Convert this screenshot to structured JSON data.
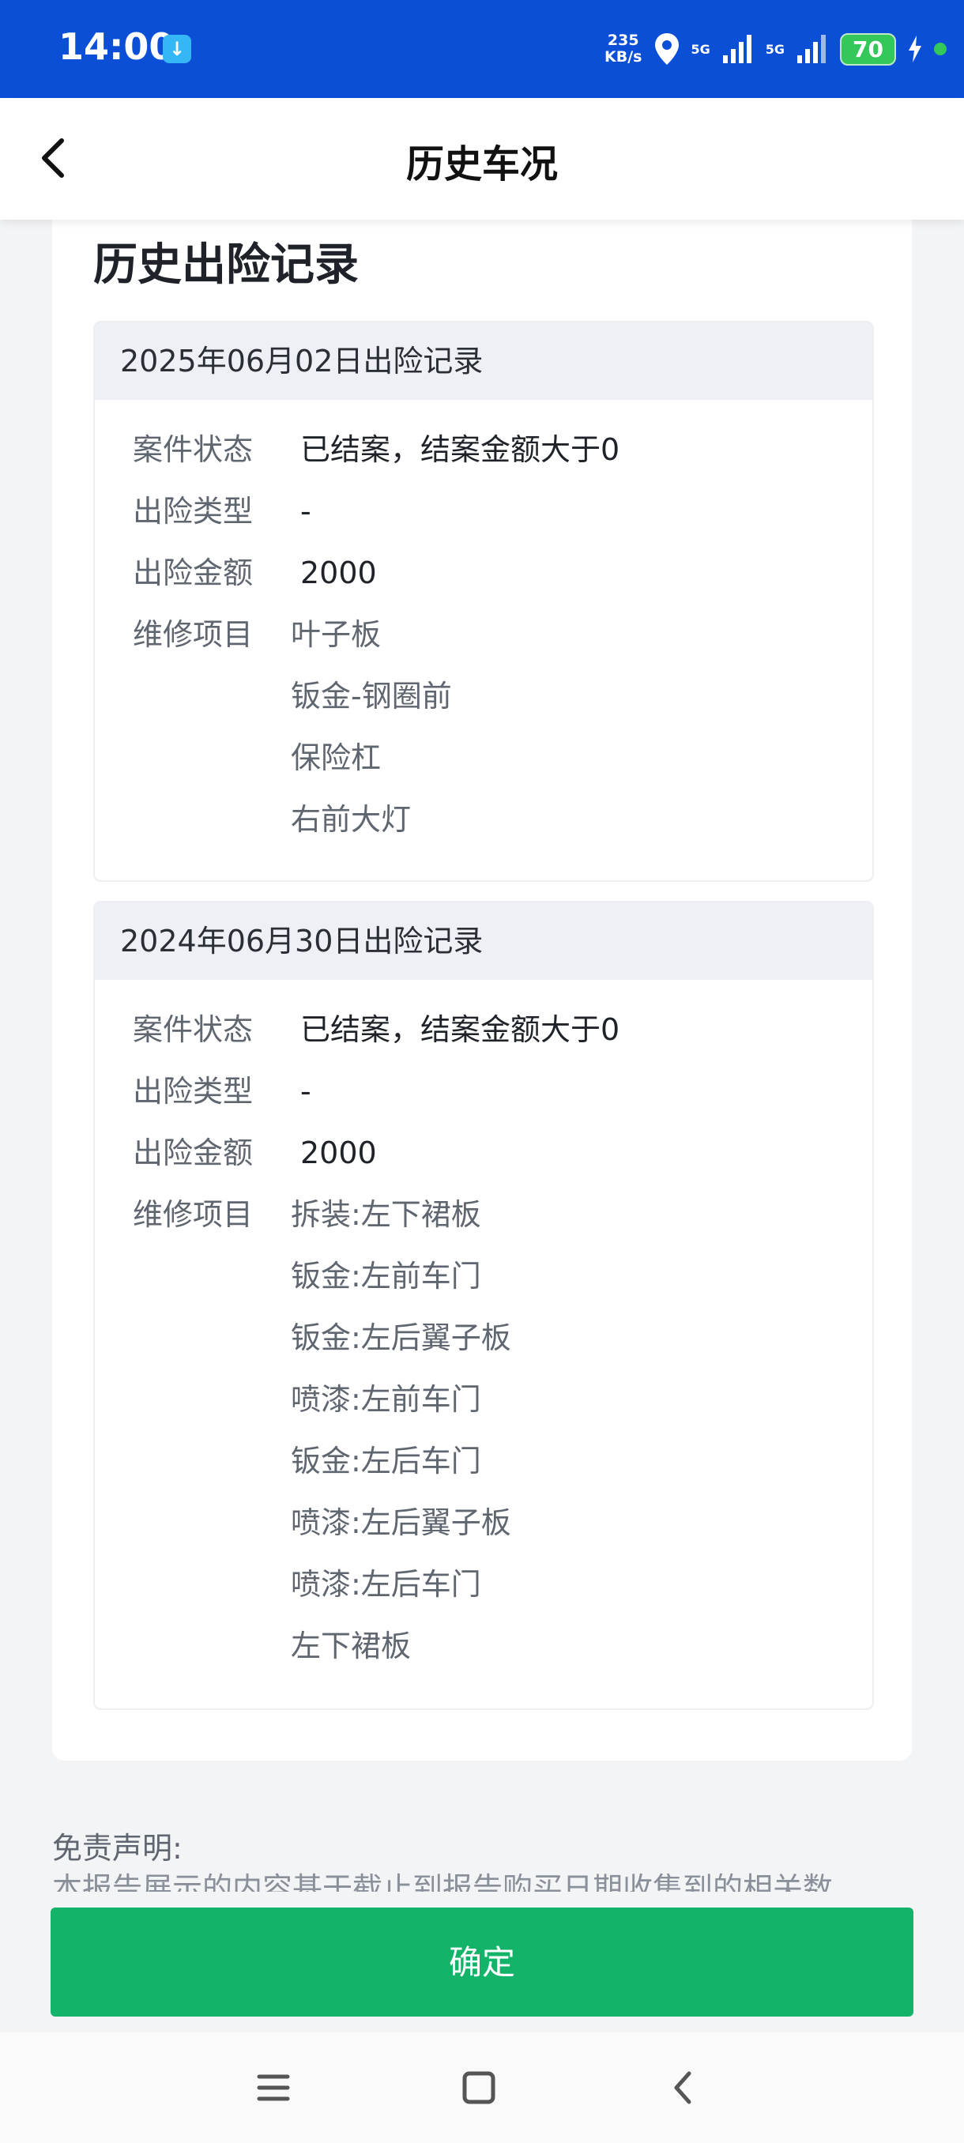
{
  "status_bar": {
    "time": "14:00",
    "app_icon": "app-notification-icon",
    "speed_value": "235",
    "speed_unit": "KB/s",
    "net1": "5G",
    "net2": "5G",
    "battery": "70"
  },
  "header": {
    "title": "历史车况"
  },
  "section_title": "历史出险记录",
  "records": [
    {
      "header": "2025年06月02日出险记录",
      "status_label": "案件状态",
      "status_value": "已结案，结案金额大于0",
      "type_label": "出险类型",
      "type_value": "-",
      "amount_label": "出险金额",
      "amount_value": "2000",
      "repair_label": "维修项目",
      "repair_items": [
        "叶子板",
        "钣金-钢圈前",
        "保险杠",
        "右前大灯"
      ]
    },
    {
      "header": "2024年06月30日出险记录",
      "status_label": "案件状态",
      "status_value": "已结案，结案金额大于0",
      "type_label": "出险类型",
      "type_value": "-",
      "amount_label": "出险金额",
      "amount_value": "2000",
      "repair_label": "维修项目",
      "repair_items": [
        "拆装:左下裙板",
        "钣金:左前车门",
        "钣金:左后翼子板",
        "喷漆:左前车门",
        "钣金:左后车门",
        "喷漆:左后翼子板",
        "喷漆:左后车门",
        "左下裙板"
      ]
    }
  ],
  "disclaimer": {
    "title": "免责声明:",
    "text": "本报告展示的内容基于截止到报告购买日期收集到的相关数"
  },
  "confirm_button": "确定",
  "colors": {
    "status_bar": "#0a4fd6",
    "primary_green": "#13b36a"
  }
}
